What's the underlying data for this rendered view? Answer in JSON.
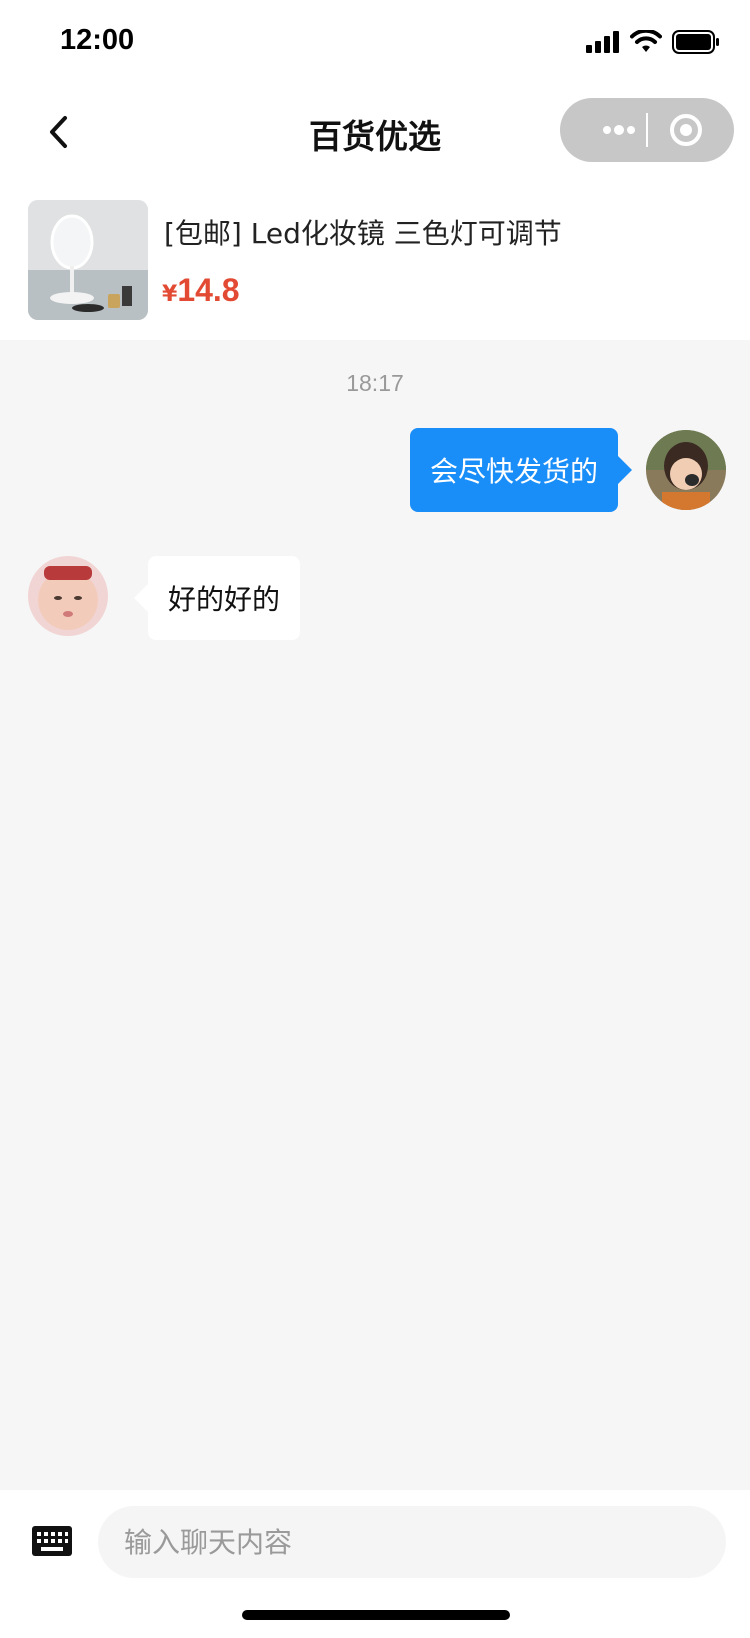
{
  "status_bar": {
    "time": "12:00"
  },
  "nav": {
    "title": "百货优选"
  },
  "product": {
    "title": "[包邮] Led化妆镜 三色灯可调节",
    "currency": "¥",
    "price": "14.8"
  },
  "chat": {
    "timestamp": "18:17",
    "messages": [
      {
        "side": "outgoing",
        "text": "会尽快发货的"
      },
      {
        "side": "incoming",
        "text": "好的好的"
      }
    ]
  },
  "input": {
    "placeholder": "输入聊天内容"
  },
  "colors": {
    "accent_blue": "#1a8ef8",
    "price_red": "#e34a33",
    "chat_background": "#f6f6f6"
  }
}
